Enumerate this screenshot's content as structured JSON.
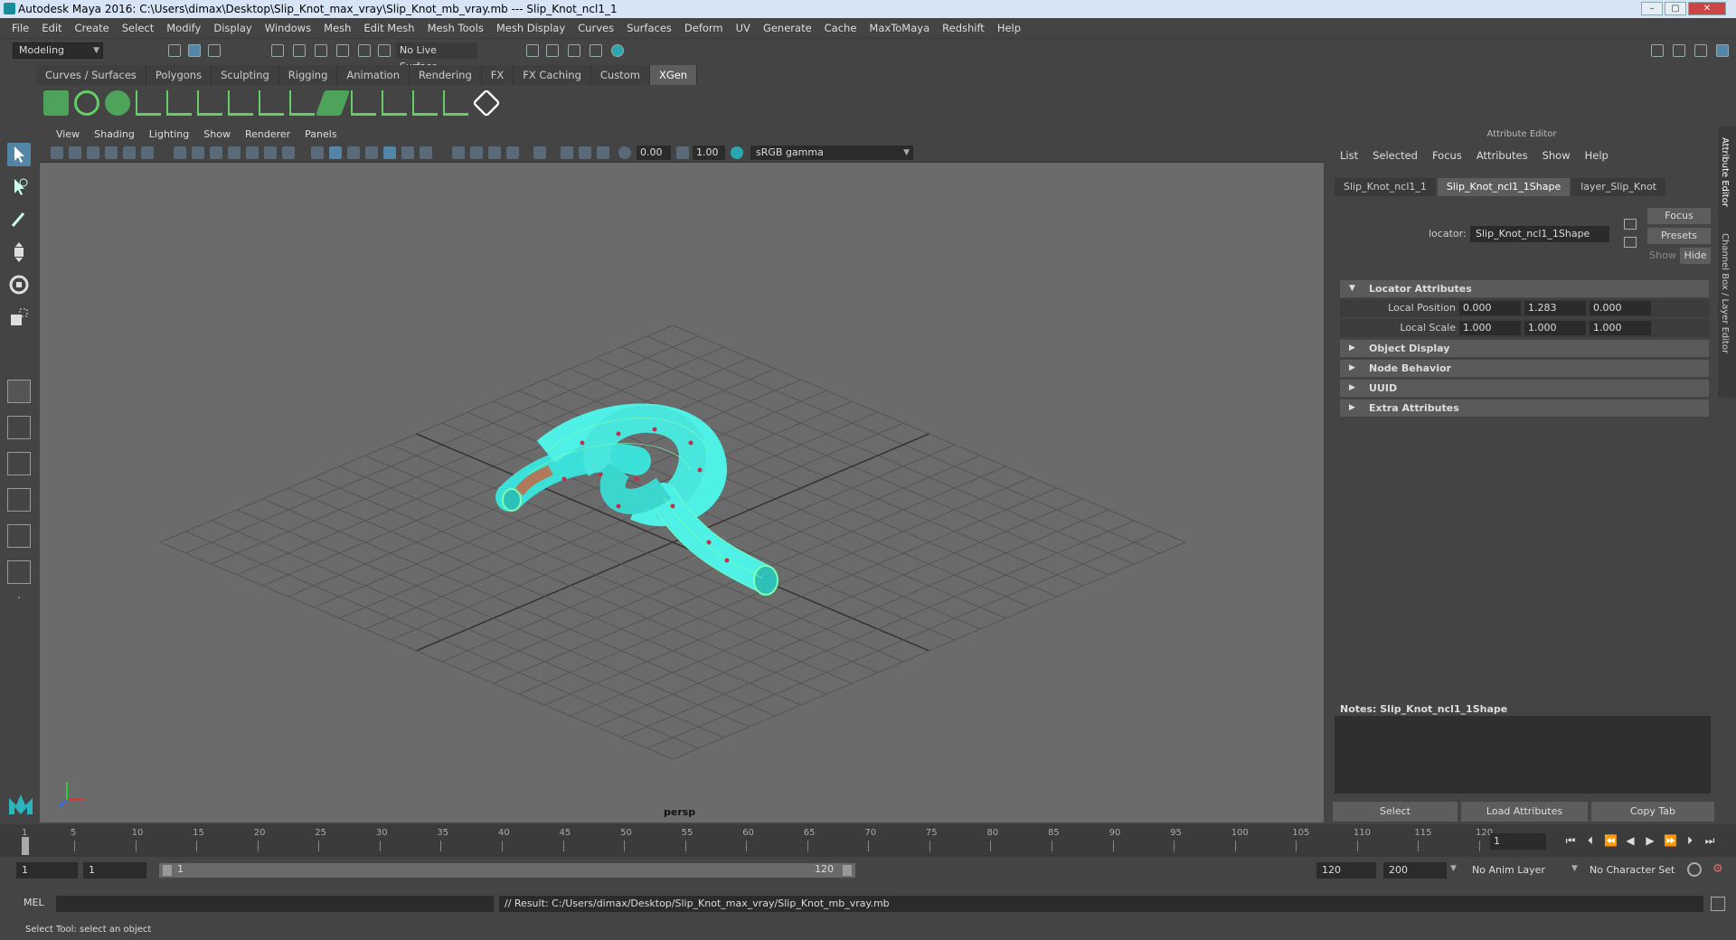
{
  "window": {
    "title": "Autodesk Maya 2016: C:\\Users\\dimax\\Desktop\\Slip_Knot_max_vray\\Slip_Knot_mb_vray.mb   ---   Slip_Knot_ncl1_1",
    "minimize": "–",
    "maximize": "▢",
    "close": "✕"
  },
  "menubar": [
    "File",
    "Edit",
    "Create",
    "Select",
    "Modify",
    "Display",
    "Windows",
    "Mesh",
    "Edit Mesh",
    "Mesh Tools",
    "Mesh Display",
    "Curves",
    "Surfaces",
    "Deform",
    "UV",
    "Generate",
    "Cache",
    "MaxToMaya",
    "Redshift",
    "Help"
  ],
  "statusline": {
    "mode": "Modeling",
    "live_surface": "No Live Surface"
  },
  "shelf": {
    "tabs": [
      "Curves / Surfaces",
      "Polygons",
      "Sculpting",
      "Rigging",
      "Animation",
      "Rendering",
      "FX",
      "FX Caching",
      "Custom",
      "XGen"
    ],
    "active_tab": "XGen"
  },
  "viewport": {
    "menu": [
      "View",
      "Shading",
      "Lighting",
      "Show",
      "Renderer",
      "Panels"
    ],
    "exposure": "0.00",
    "gamma_value": "1.00",
    "color_space": "sRGB gamma",
    "camera_label": "persp"
  },
  "attribute_editor": {
    "header": "Attribute Editor",
    "menu": [
      "List",
      "Selected",
      "Focus",
      "Attributes",
      "Show",
      "Help"
    ],
    "tabs": [
      "Slip_Knot_ncl1_1",
      "Slip_Knot_ncl1_1Shape",
      "layer_Slip_Knot"
    ],
    "active_tab": "Slip_Knot_ncl1_1Shape",
    "node_type_label": "locator:",
    "node_name": "Slip_Knot_ncl1_1Shape",
    "focus_btn": "Focus",
    "presets_btn": "Presets",
    "show_btn": "Show",
    "hide_btn": "Hide",
    "sections": {
      "locator": "Locator Attributes",
      "object_display": "Object Display",
      "node_behavior": "Node Behavior",
      "uuid": "UUID",
      "extra": "Extra Attributes"
    },
    "local_position": {
      "label": "Local Position",
      "x": "0.000",
      "y": "1.283",
      "z": "0.000"
    },
    "local_scale": {
      "label": "Local Scale",
      "x": "1.000",
      "y": "1.000",
      "z": "1.000"
    },
    "notes_label": "Notes:  Slip_Knot_ncl1_1Shape",
    "buttons": {
      "select": "Select",
      "load": "Load Attributes",
      "copy": "Copy Tab"
    }
  },
  "side_tabs": [
    "Attribute Editor",
    "Channel Box / Layer Editor"
  ],
  "timeslider": {
    "ticks": [
      "1",
      "5",
      "10",
      "15",
      "20",
      "25",
      "30",
      "35",
      "40",
      "45",
      "50",
      "55",
      "60",
      "65",
      "70",
      "75",
      "80",
      "85",
      "90",
      "95",
      "100",
      "105",
      "110",
      "115",
      "120"
    ],
    "current_frame": "1"
  },
  "rangeslider": {
    "start": "1",
    "playback_start": "1",
    "range_start": "1",
    "range_end": "120",
    "playback_end": "120",
    "end": "200",
    "anim_layer": "No Anim Layer",
    "character_set": "No Character Set"
  },
  "commandline": {
    "lang": "MEL",
    "result": "// Result: C:/Users/dimax/Desktop/Slip_Knot_max_vray/Slip_Knot_mb_vray.mb"
  },
  "helpline": "Select Tool: select an object",
  "colors": {
    "accent": "#5285a6",
    "knot": "#4ff0e6",
    "wire": "#7dffb0",
    "viewport_bg": "#6b6b6b",
    "grid": "#505050"
  }
}
